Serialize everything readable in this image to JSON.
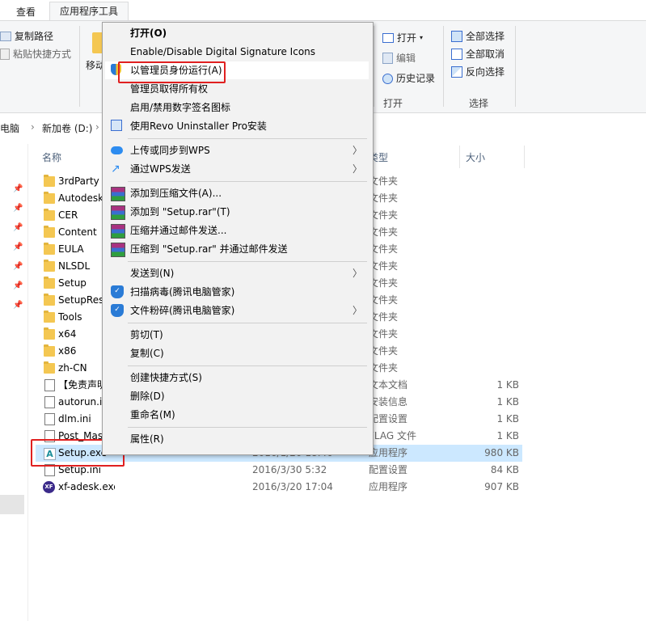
{
  "ribbon": {
    "tabs": [
      "查看",
      "应用程序工具"
    ],
    "clipboard": {
      "copy_path": "复制路径",
      "paste_shortcut": "粘贴快捷方式",
      "move_to": "移动"
    },
    "open_group": {
      "open": "打开",
      "edit": "编辑",
      "history": "历史记录",
      "label": "打开"
    },
    "select_group": {
      "select_all": "全部选择",
      "select_none": "全部取消",
      "invert": "反向选择",
      "label": "选择"
    }
  },
  "address": {
    "this_pc": "电脑",
    "drive": "新加卷 (D:)"
  },
  "columns": {
    "name": "名称",
    "type": "类型",
    "size": "大小"
  },
  "files": [
    {
      "name": "3rdParty",
      "date": "",
      "type": "文件夹",
      "size": "",
      "icon": "folder-icon"
    },
    {
      "name": "Autodesk",
      "date": "",
      "type": "文件夹",
      "size": "",
      "icon": "folder-icon"
    },
    {
      "name": "CER",
      "date": "",
      "type": "文件夹",
      "size": "",
      "icon": "folder-icon"
    },
    {
      "name": "Content",
      "date": "",
      "type": "文件夹",
      "size": "",
      "icon": "folder-icon"
    },
    {
      "name": "EULA",
      "date": "",
      "type": "文件夹",
      "size": "",
      "icon": "folder-icon"
    },
    {
      "name": "NLSDL",
      "date": "",
      "type": "文件夹",
      "size": "",
      "icon": "folder-icon"
    },
    {
      "name": "Setup",
      "date": "",
      "type": "文件夹",
      "size": "",
      "icon": "folder-icon"
    },
    {
      "name": "SetupRes",
      "date": "",
      "type": "文件夹",
      "size": "",
      "icon": "folder-icon"
    },
    {
      "name": "Tools",
      "date": "",
      "type": "文件夹",
      "size": "",
      "icon": "folder-icon"
    },
    {
      "name": "x64",
      "date": "",
      "type": "文件夹",
      "size": "",
      "icon": "folder-icon"
    },
    {
      "name": "x86",
      "date": "",
      "type": "文件夹",
      "size": "",
      "icon": "folder-icon"
    },
    {
      "name": "zh-CN",
      "date": "",
      "type": "文件夹",
      "size": "",
      "icon": "folder-icon"
    },
    {
      "name": "【免责声明",
      "date": "",
      "type": "文本文档",
      "size": "1 KB",
      "icon": "text-file-icon"
    },
    {
      "name": "autorun.inf",
      "date": "",
      "type": "安装信息",
      "size": "1 KB",
      "icon": "settings-file-icon"
    },
    {
      "name": "dlm.ini",
      "date": "",
      "type": "配置设置",
      "size": "1 KB",
      "icon": "settings-file-icon"
    },
    {
      "name": "Post_Mas",
      "date": "",
      "type": "FLAG 文件",
      "size": "1 KB",
      "icon": "file-icon"
    },
    {
      "name": "Setup.exe",
      "date": "2016/1/20 18:40",
      "type": "应用程序",
      "size": "980 KB",
      "icon": "autodesk-app-icon"
    },
    {
      "name": "Setup.ini",
      "date": "2016/3/30 5:32",
      "type": "配置设置",
      "size": "84 KB",
      "icon": "settings-file-icon"
    },
    {
      "name": "xf-adesk.exe",
      "date": "2016/3/20 17:04",
      "type": "应用程序",
      "size": "907 KB",
      "icon": "xf-app-icon"
    }
  ],
  "menu": {
    "open": "打开(O)",
    "digital_sig": "Enable/Disable Digital Signature Icons",
    "run_as_admin": "以管理员身份运行(A)",
    "take_ownership": "管理员取得所有权",
    "toggle_sig": "启用/禁用数字签名图标",
    "revo": "使用Revo Uninstaller Pro安装",
    "wps_upload": "上传或同步到WPS",
    "wps_send": "通过WPS发送",
    "add_archive": "添加到压缩文件(A)...",
    "add_setup_rar": "添加到 \"Setup.rar\"(T)",
    "compress_email": "压缩并通过邮件发送...",
    "compress_setup_email": "压缩到 \"Setup.rar\" 并通过邮件发送",
    "send_to": "发送到(N)",
    "scan_virus": "扫描病毒(腾讯电脑管家)",
    "shred": "文件粉碎(腾讯电脑管家)",
    "cut": "剪切(T)",
    "copy": "复制(C)",
    "create_shortcut": "创建快捷方式(S)",
    "delete": "删除(D)",
    "rename": "重命名(M)",
    "properties": "属性(R)"
  }
}
